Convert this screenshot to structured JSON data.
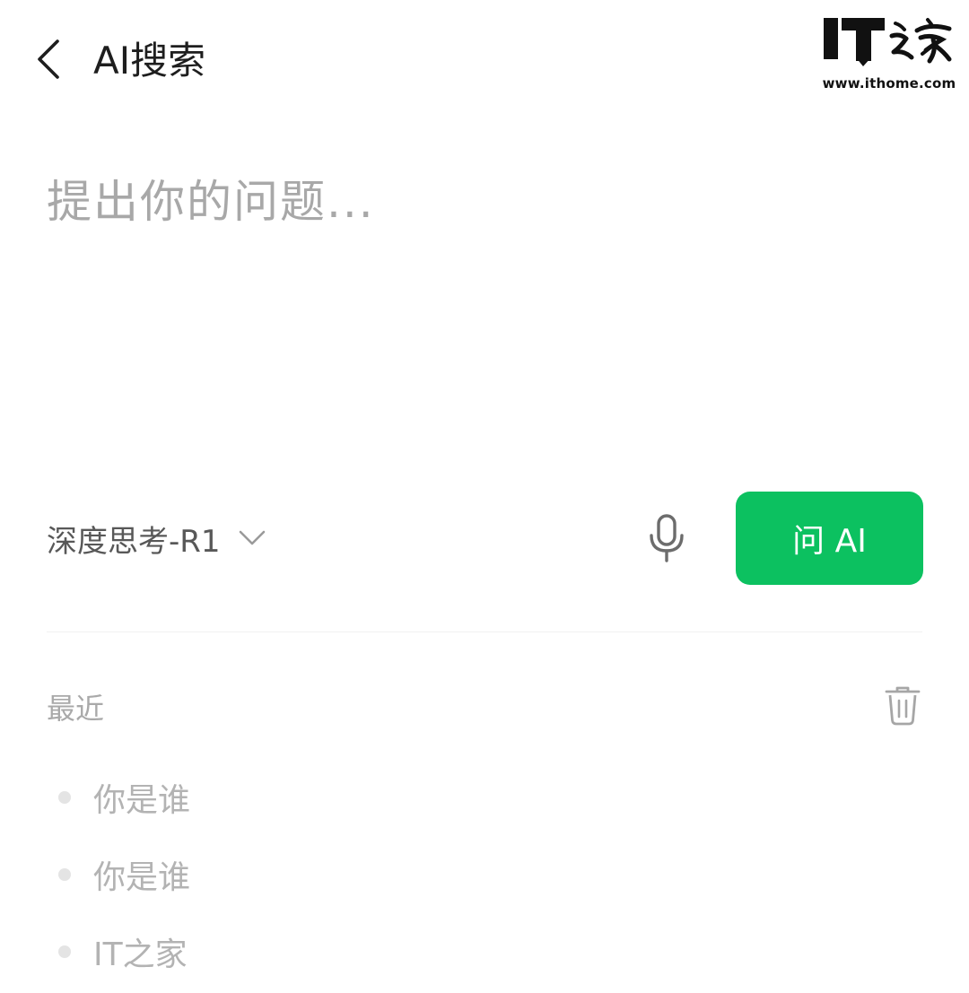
{
  "header": {
    "title": "AI搜索",
    "back_icon": "chevron-left-icon"
  },
  "watermark": {
    "logo_text": "IT之家",
    "url": "www.ithome.com"
  },
  "search": {
    "placeholder": "提出你的问题...",
    "value": ""
  },
  "controls": {
    "model_label": "深度思考-R1",
    "dropdown_icon": "chevron-down-icon",
    "mic_icon": "microphone-icon",
    "ask_button_label": "问 AI",
    "ask_button_color": "#0cc160"
  },
  "recent": {
    "title": "最近",
    "clear_icon": "trash-icon",
    "items": [
      {
        "label": "你是谁"
      },
      {
        "label": "你是谁"
      },
      {
        "label": "IT之家"
      }
    ]
  }
}
